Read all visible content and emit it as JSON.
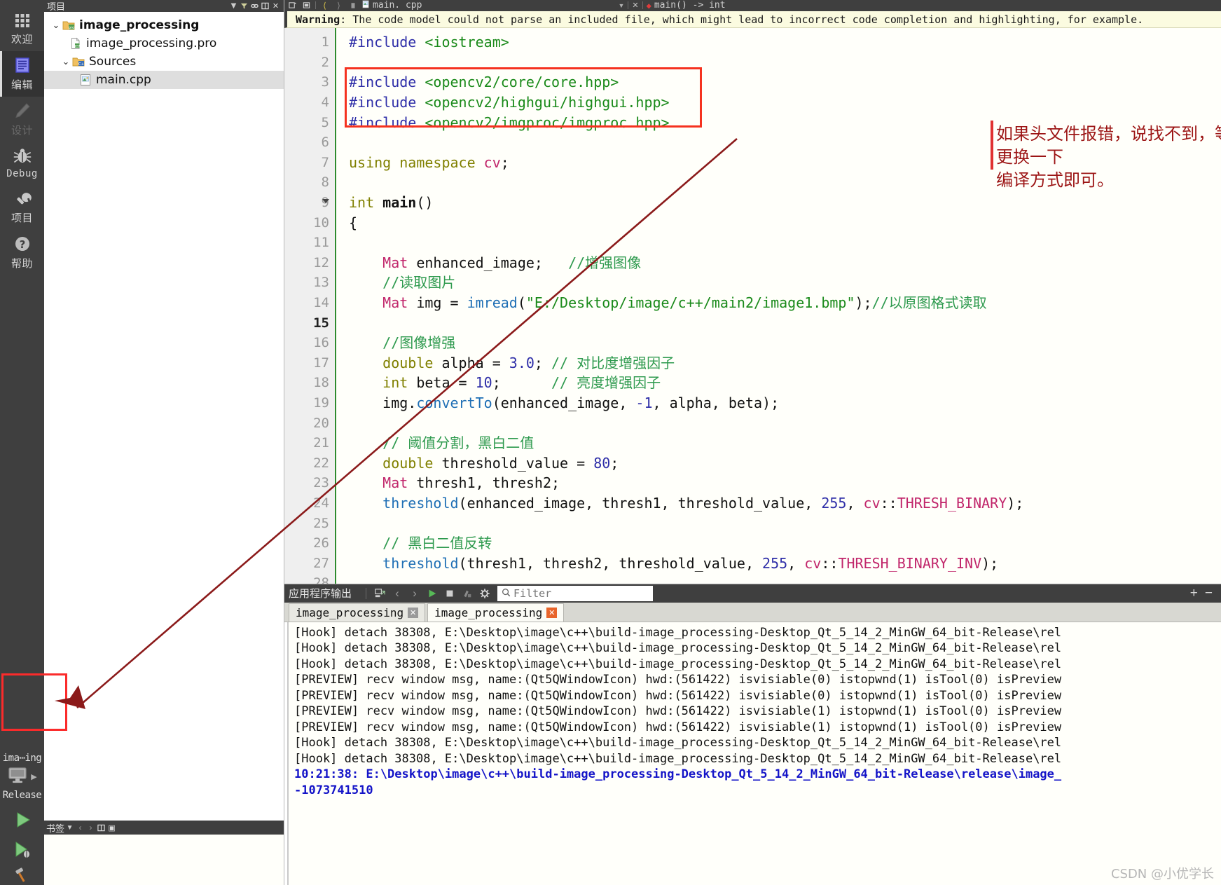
{
  "modebar": {
    "items": [
      {
        "label": "欢迎",
        "icon": "grid-icon",
        "state": "normal"
      },
      {
        "label": "编辑",
        "icon": "document-icon",
        "state": "selected"
      },
      {
        "label": "设计",
        "icon": "pencil-icon",
        "state": "disabled"
      },
      {
        "label": "Debug",
        "icon": "bug-icon",
        "state": "normal"
      },
      {
        "label": "项目",
        "icon": "wrench-icon",
        "state": "normal"
      },
      {
        "label": "帮助",
        "icon": "help-icon",
        "state": "normal"
      }
    ],
    "kit": {
      "project": "ima⋯ing",
      "build_config": "Release",
      "icon": "monitor-icon"
    },
    "run_icon": "run-triangle-icon",
    "debug_icon": "debug-run-icon",
    "build_icon": "hammer-icon"
  },
  "left_pane": {
    "title": "项目",
    "tree": [
      {
        "label": "image_processing",
        "icon": "project-folder-icon",
        "indent": 0,
        "arrow": "⌄",
        "bold": true,
        "selected": false
      },
      {
        "label": "image_processing.pro",
        "icon": "pro-file-icon",
        "indent": 1,
        "arrow": "",
        "bold": false,
        "selected": false
      },
      {
        "label": "Sources",
        "icon": "sources-folder-icon",
        "indent": 1,
        "arrow": "⌄",
        "bold": false,
        "selected": false
      },
      {
        "label": "main.cpp",
        "icon": "cpp-file-icon",
        "indent": 2,
        "arrow": "",
        "bold": false,
        "selected": true
      }
    ],
    "bookmarks_title": "书签"
  },
  "editor_toolbar": {
    "file_name": "main. cpp",
    "symbol": "main() -> int",
    "back_icon": "back-arrow-icon",
    "forward_icon": "forward-arrow-icon",
    "split_icon": "split-editor-icon",
    "close_icon": "close-icon"
  },
  "warning": {
    "prefix": "Warning",
    "text": ": The code model could not parse an included file, which might lead to incorrect code completion and highlighting, for example."
  },
  "code": {
    "lines": [
      {
        "n": 1,
        "current": false,
        "fold": false,
        "tokens": [
          {
            "t": "#include",
            "c": "pre"
          },
          {
            "t": " ",
            "c": "id"
          },
          {
            "t": "<iostream>",
            "c": "str"
          }
        ]
      },
      {
        "n": 2,
        "current": false,
        "fold": false,
        "tokens": []
      },
      {
        "n": 3,
        "current": false,
        "fold": false,
        "tokens": [
          {
            "t": "#include",
            "c": "pre"
          },
          {
            "t": " ",
            "c": "id"
          },
          {
            "t": "<opencv2/core/core.hpp>",
            "c": "str"
          }
        ]
      },
      {
        "n": 4,
        "current": false,
        "fold": false,
        "tokens": [
          {
            "t": "#include",
            "c": "pre"
          },
          {
            "t": " ",
            "c": "id"
          },
          {
            "t": "<opencv2/highgui/highgui.hpp>",
            "c": "str"
          }
        ]
      },
      {
        "n": 5,
        "current": false,
        "fold": false,
        "tokens": [
          {
            "t": "#include",
            "c": "pre"
          },
          {
            "t": " ",
            "c": "id"
          },
          {
            "t": "<opencv2/imgproc/imgproc.hpp>",
            "c": "str"
          }
        ]
      },
      {
        "n": 6,
        "current": false,
        "fold": false,
        "tokens": []
      },
      {
        "n": 7,
        "current": false,
        "fold": false,
        "tokens": [
          {
            "t": "using namespace ",
            "c": "kw"
          },
          {
            "t": "cv",
            "c": "type"
          },
          {
            "t": ";",
            "c": "id"
          }
        ]
      },
      {
        "n": 8,
        "current": false,
        "fold": false,
        "tokens": []
      },
      {
        "n": 9,
        "current": false,
        "fold": true,
        "tokens": [
          {
            "t": "int ",
            "c": "kw"
          },
          {
            "t": "main",
            "c": "bold"
          },
          {
            "t": "()",
            "c": "id"
          }
        ]
      },
      {
        "n": 10,
        "current": false,
        "fold": false,
        "tokens": [
          {
            "t": "{",
            "c": "id"
          }
        ]
      },
      {
        "n": 11,
        "current": false,
        "fold": false,
        "tokens": []
      },
      {
        "n": 12,
        "current": false,
        "fold": false,
        "tokens": [
          {
            "t": "    ",
            "c": "id"
          },
          {
            "t": "Mat",
            "c": "type"
          },
          {
            "t": " enhanced_image;   ",
            "c": "id"
          },
          {
            "t": "//增强图像",
            "c": "cmt"
          }
        ]
      },
      {
        "n": 13,
        "current": false,
        "fold": false,
        "tokens": [
          {
            "t": "    ",
            "c": "id"
          },
          {
            "t": "//读取图片",
            "c": "cmt"
          }
        ]
      },
      {
        "n": 14,
        "current": false,
        "fold": false,
        "tokens": [
          {
            "t": "    ",
            "c": "id"
          },
          {
            "t": "Mat",
            "c": "type"
          },
          {
            "t": " img = ",
            "c": "id"
          },
          {
            "t": "imread",
            "c": "fn"
          },
          {
            "t": "(",
            "c": "id"
          },
          {
            "t": "\"E:/Desktop/image/c++/main2/image1.bmp\"",
            "c": "str"
          },
          {
            "t": ");",
            "c": "id"
          },
          {
            "t": "//以原图格式读取",
            "c": "cmt"
          }
        ]
      },
      {
        "n": 15,
        "current": true,
        "fold": false,
        "tokens": []
      },
      {
        "n": 16,
        "current": false,
        "fold": false,
        "tokens": [
          {
            "t": "    ",
            "c": "id"
          },
          {
            "t": "//图像增强",
            "c": "cmt"
          }
        ]
      },
      {
        "n": 17,
        "current": false,
        "fold": false,
        "tokens": [
          {
            "t": "    ",
            "c": "id"
          },
          {
            "t": "double",
            "c": "kw"
          },
          {
            "t": " alpha = ",
            "c": "id"
          },
          {
            "t": "3.0",
            "c": "num"
          },
          {
            "t": "; ",
            "c": "id"
          },
          {
            "t": "// 对比度增强因子",
            "c": "cmt"
          }
        ]
      },
      {
        "n": 18,
        "current": false,
        "fold": false,
        "tokens": [
          {
            "t": "    ",
            "c": "id"
          },
          {
            "t": "int",
            "c": "kw"
          },
          {
            "t": " beta = ",
            "c": "id"
          },
          {
            "t": "10",
            "c": "num"
          },
          {
            "t": ";      ",
            "c": "id"
          },
          {
            "t": "// 亮度增强因子",
            "c": "cmt"
          }
        ]
      },
      {
        "n": 19,
        "current": false,
        "fold": false,
        "tokens": [
          {
            "t": "    img.",
            "c": "id"
          },
          {
            "t": "convertTo",
            "c": "fn"
          },
          {
            "t": "(enhanced_image, ",
            "c": "id"
          },
          {
            "t": "-1",
            "c": "num"
          },
          {
            "t": ", alpha, beta);",
            "c": "id"
          }
        ]
      },
      {
        "n": 20,
        "current": false,
        "fold": false,
        "tokens": []
      },
      {
        "n": 21,
        "current": false,
        "fold": false,
        "tokens": [
          {
            "t": "    ",
            "c": "id"
          },
          {
            "t": "// 阈值分割，黑白二值",
            "c": "cmt"
          }
        ]
      },
      {
        "n": 22,
        "current": false,
        "fold": false,
        "tokens": [
          {
            "t": "    ",
            "c": "id"
          },
          {
            "t": "double",
            "c": "kw"
          },
          {
            "t": " threshold_value = ",
            "c": "id"
          },
          {
            "t": "80",
            "c": "num"
          },
          {
            "t": ";",
            "c": "id"
          }
        ]
      },
      {
        "n": 23,
        "current": false,
        "fold": false,
        "tokens": [
          {
            "t": "    ",
            "c": "id"
          },
          {
            "t": "Mat",
            "c": "type"
          },
          {
            "t": " thresh1, thresh2;",
            "c": "id"
          }
        ]
      },
      {
        "n": 24,
        "current": false,
        "fold": false,
        "tokens": [
          {
            "t": "    ",
            "c": "id"
          },
          {
            "t": "threshold",
            "c": "fn"
          },
          {
            "t": "(enhanced_image, thresh1, threshold_value, ",
            "c": "id"
          },
          {
            "t": "255",
            "c": "num"
          },
          {
            "t": ", ",
            "c": "id"
          },
          {
            "t": "cv",
            "c": "type"
          },
          {
            "t": "::",
            "c": "id"
          },
          {
            "t": "THRESH_BINARY",
            "c": "type"
          },
          {
            "t": ");",
            "c": "id"
          }
        ]
      },
      {
        "n": 25,
        "current": false,
        "fold": false,
        "tokens": []
      },
      {
        "n": 26,
        "current": false,
        "fold": false,
        "tokens": [
          {
            "t": "    ",
            "c": "id"
          },
          {
            "t": "// 黑白二值反转",
            "c": "cmt"
          }
        ]
      },
      {
        "n": 27,
        "current": false,
        "fold": false,
        "tokens": [
          {
            "t": "    ",
            "c": "id"
          },
          {
            "t": "threshold",
            "c": "fn"
          },
          {
            "t": "(thresh1, thresh2, threshold_value, ",
            "c": "id"
          },
          {
            "t": "255",
            "c": "num"
          },
          {
            "t": ", ",
            "c": "id"
          },
          {
            "t": "cv",
            "c": "type"
          },
          {
            "t": "::",
            "c": "id"
          },
          {
            "t": "THRESH_BINARY_INV",
            "c": "type"
          },
          {
            "t": ");",
            "c": "id"
          }
        ]
      },
      {
        "n": 28,
        "current": false,
        "fold": false,
        "tokens": []
      }
    ]
  },
  "annotation": {
    "text_line1": "如果头文件报错，说找不到，等问题。则需要点击，更换一下",
    "text_line2": "编译方式即可。",
    "color": "#9c1515",
    "box_color": "#f5321f"
  },
  "output_pane": {
    "title": "应用程序输出",
    "filter_placeholder": "Filter",
    "search_icon": "search-icon",
    "gear_icon": "gear-icon",
    "run_icon": "run-icon",
    "stop_icon": "stop-icon",
    "clean_icon": "clean-icon",
    "prev_icon": "prev-icon",
    "next_icon": "next-icon",
    "plus_label": "+",
    "minus_label": "−",
    "tabs": [
      {
        "label": "image_processing",
        "active": false,
        "close_red": false
      },
      {
        "label": "image_processing",
        "active": true,
        "close_red": true
      }
    ],
    "lines": [
      {
        "text": "[Hook] detach 38308, E:\\Desktop\\image\\c++\\build-image_processing-Desktop_Qt_5_14_2_MinGW_64_bit-Release\\rel",
        "link": false
      },
      {
        "text": "[Hook] detach 38308, E:\\Desktop\\image\\c++\\build-image_processing-Desktop_Qt_5_14_2_MinGW_64_bit-Release\\rel",
        "link": false
      },
      {
        "text": "[Hook] detach 38308, E:\\Desktop\\image\\c++\\build-image_processing-Desktop_Qt_5_14_2_MinGW_64_bit-Release\\rel",
        "link": false
      },
      {
        "text": "[PREVIEW] recv window msg, name:(Qt5QWindowIcon) hwd:(561422) isvisiable(0) istopwnd(1) isTool(0) isPreview",
        "link": false
      },
      {
        "text": "[PREVIEW] recv window msg, name:(Qt5QWindowIcon) hwd:(561422) isvisiable(0) istopwnd(1) isTool(0) isPreview",
        "link": false
      },
      {
        "text": "[PREVIEW] recv window msg, name:(Qt5QWindowIcon) hwd:(561422) isvisiable(1) istopwnd(1) isTool(0) isPreview",
        "link": false
      },
      {
        "text": "[PREVIEW] recv window msg, name:(Qt5QWindowIcon) hwd:(561422) isvisiable(1) istopwnd(1) isTool(0) isPreview",
        "link": false
      },
      {
        "text": "[Hook] detach 38308, E:\\Desktop\\image\\c++\\build-image_processing-Desktop_Qt_5_14_2_MinGW_64_bit-Release\\rel",
        "link": false
      },
      {
        "text": "[Hook] detach 38308, E:\\Desktop\\image\\c++\\build-image_processing-Desktop_Qt_5_14_2_MinGW_64_bit-Release\\rel",
        "link": false
      },
      {
        "text": "10:21:38: E:\\Desktop\\image\\c++\\build-image_processing-Desktop_Qt_5_14_2_MinGW_64_bit-Release\\release\\image_",
        "link": true
      },
      {
        "text": "-1073741510",
        "link": true
      }
    ]
  },
  "watermark": {
    "text": "CSDN @小优学长"
  }
}
